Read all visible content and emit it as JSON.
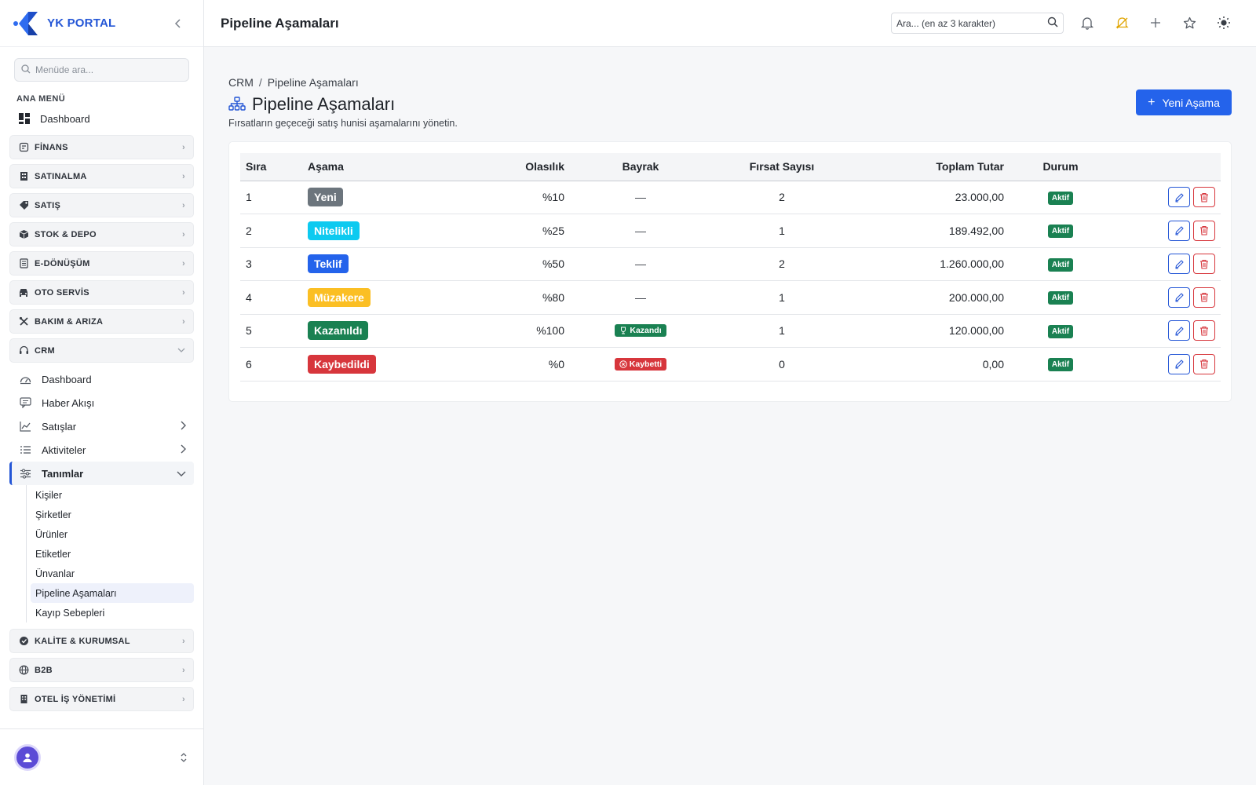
{
  "brand": {
    "name": "YK PORTAL"
  },
  "sidebar": {
    "search_placeholder": "Menüde ara...",
    "section_title": "ANA MENÜ",
    "dashboard_label": "Dashboard",
    "groups_top": [
      {
        "label": "FİNANS",
        "icon": "finance-icon"
      },
      {
        "label": "SATINALMA",
        "icon": "building-icon"
      },
      {
        "label": "SATIŞ",
        "icon": "tag-icon"
      },
      {
        "label": "STOK & DEPO",
        "icon": "box-icon"
      },
      {
        "label": "E-DÖNÜŞÜM",
        "icon": "document-icon"
      },
      {
        "label": "OTO SERVİS",
        "icon": "car-icon"
      },
      {
        "label": "BAKIM & ARIZA",
        "icon": "tools-icon"
      }
    ],
    "crm": {
      "label": "CRM",
      "items": [
        {
          "label": "Dashboard",
          "icon": "gauge-icon"
        },
        {
          "label": "Haber Akışı",
          "icon": "chat-icon"
        },
        {
          "label": "Satışlar",
          "icon": "chart-line-icon"
        },
        {
          "label": "Aktiviteler",
          "icon": "list-icon"
        },
        {
          "label": "Tanımlar",
          "icon": "sliders-icon"
        }
      ],
      "leaves": [
        "Kişiler",
        "Şirketler",
        "Ürünler",
        "Etiketler",
        "Ünvanlar",
        "Pipeline Aşamaları",
        "Kayıp Sebepleri"
      ]
    },
    "groups_bottom": [
      {
        "label": "KALİTE & KURUMSAL",
        "icon": "badge-check-icon"
      },
      {
        "label": "B2B",
        "icon": "globe-icon"
      },
      {
        "label": "OTEL İŞ YÖNETİMİ",
        "icon": "hotel-icon"
      }
    ]
  },
  "header": {
    "title": "Pipeline Aşamaları",
    "search_placeholder": "Ara... (en az 3 karakter)"
  },
  "page": {
    "breadcrumb_root": "CRM",
    "breadcrumb_sep": "/",
    "breadcrumb_current": "Pipeline Aşamaları",
    "title": "Pipeline Aşamaları",
    "subtitle": "Fırsatların geçeceği satış hunisi aşamalarını yönetin.",
    "new_button": "Yeni Aşama"
  },
  "table": {
    "headers": {
      "order": "Sıra",
      "stage": "Aşama",
      "probability": "Olasılık",
      "flag": "Bayrak",
      "count": "Fırsat Sayısı",
      "total": "Toplam Tutar",
      "status": "Durum"
    },
    "rows": [
      {
        "order": "1",
        "stage": "Yeni",
        "stage_color": "#6c757d",
        "probability": "%10",
        "flag": "—",
        "count": "2",
        "total": "23.000,00",
        "status": "Aktif"
      },
      {
        "order": "2",
        "stage": "Nitelikli",
        "stage_color": "#0dcaf0",
        "probability": "%25",
        "flag": "—",
        "count": "1",
        "total": "189.492,00",
        "status": "Aktif"
      },
      {
        "order": "3",
        "stage": "Teklif",
        "stage_color": "#2463eb",
        "probability": "%50",
        "flag": "—",
        "count": "2",
        "total": "1.260.000,00",
        "status": "Aktif"
      },
      {
        "order": "4",
        "stage": "Müzakere",
        "stage_color": "#fbbf24",
        "probability": "%80",
        "flag": "—",
        "count": "1",
        "total": "200.000,00",
        "status": "Aktif"
      },
      {
        "order": "5",
        "stage": "Kazanıldı",
        "stage_color": "#1a8152",
        "probability": "%100",
        "flag": "Kazandı",
        "flag_color": "#1a8152",
        "flag_icon": "trophy-icon",
        "count": "1",
        "total": "120.000,00",
        "status": "Aktif"
      },
      {
        "order": "6",
        "stage": "Kaybedildi",
        "stage_color": "#d7363c",
        "probability": "%0",
        "flag": "Kaybetti",
        "flag_color": "#d7363c",
        "flag_icon": "x-circle-icon",
        "count": "0",
        "total": "0,00",
        "status": "Aktif"
      }
    ]
  },
  "colors": {
    "accent": "#2463eb",
    "success": "#1a8152",
    "danger": "#d7363c"
  }
}
